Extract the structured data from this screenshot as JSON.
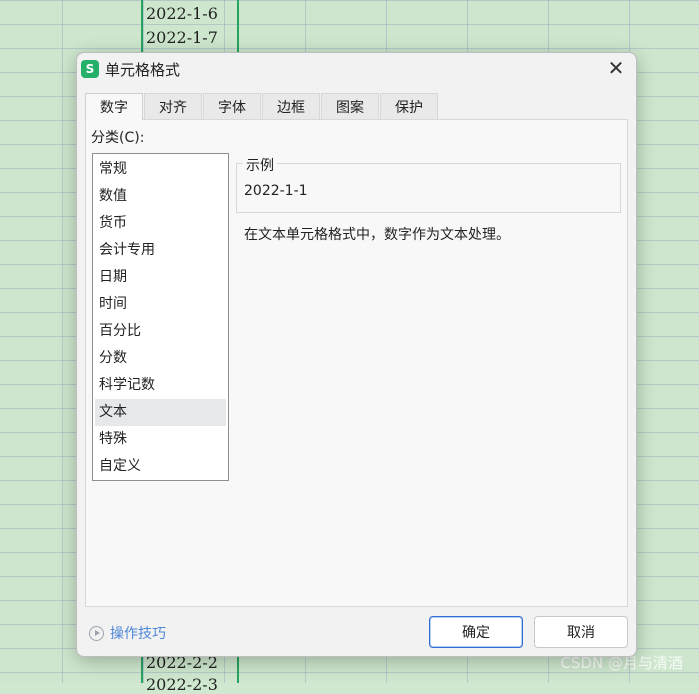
{
  "sheet": {
    "visible_cells": [
      "2022-1-6",
      "2022-1-7",
      "2022-2-2",
      "2022-2-3"
    ]
  },
  "watermark": "CSDN @月与清酒",
  "dialog": {
    "title": "单元格格式",
    "app_icon_letter": "S",
    "close_label": "✕",
    "tabs": [
      {
        "label": "数字",
        "active": true
      },
      {
        "label": "对齐",
        "active": false
      },
      {
        "label": "字体",
        "active": false
      },
      {
        "label": "边框",
        "active": false
      },
      {
        "label": "图案",
        "active": false
      },
      {
        "label": "保护",
        "active": false
      }
    ],
    "category_label": "分类(C):",
    "categories": [
      "常规",
      "数值",
      "货币",
      "会计专用",
      "日期",
      "时间",
      "百分比",
      "分数",
      "科学记数",
      "文本",
      "特殊",
      "自定义"
    ],
    "selected_category": "文本",
    "sample": {
      "legend": "示例",
      "value": "2022-1-1"
    },
    "description": "在文本单元格格式中，数字作为文本处理。",
    "tips_label": "操作技巧",
    "ok_label": "确定",
    "cancel_label": "取消"
  },
  "colors": {
    "accent_green": "#27a360",
    "link_blue": "#4f86d6",
    "primary_border": "#2f6bd1"
  }
}
